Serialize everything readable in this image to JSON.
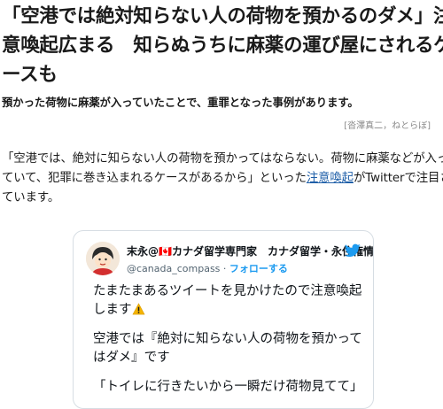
{
  "headline": {
    "line1": "「空港では絶対知らない人の荷物を預かるのダメ」注",
    "line2": "意喚起広まる　知らぬうちに麻薬の運び屋にされるケ",
    "line3": "ースも"
  },
  "lead": "預かった荷物に麻薬が入っていたことで、重罪となった事例があります。",
  "credit": "[沓澤真二，ねとらぼ]",
  "body": {
    "line1": "「空港では、絶対に知らない人の荷物を預かってはならない。荷物に麻薬などが入っ",
    "line2_pre": "ていて、犯罪に巻き込まれるケースがあるから」といった",
    "line2_link": "注意喚起",
    "line2_post": "がTwitterで注目され",
    "line3": "ています。"
  },
  "tweet": {
    "author_name": "末永@🇨🇦カナダ留学専門家　カナダ留学・永住権情...",
    "handle": "@canada_compass",
    "separator": " · ",
    "follow_label": "フォローする",
    "text_line1": "たまたまあるツイートを見かけたので注意喚起",
    "text_line2": "します",
    "text_line3": "空港では『絶対に知らない人の荷物を預かって",
    "text_line4": "はダメ』です",
    "text_line5": "「トイレに行きたいから一瞬だけ荷物見てて」",
    "icons": {
      "brand": "twitter-bird-icon",
      "warning": "warning-icon"
    },
    "colors": {
      "accent": "#1d9bf0",
      "link": "#1f5fa8",
      "warning": "#f5b400"
    }
  }
}
